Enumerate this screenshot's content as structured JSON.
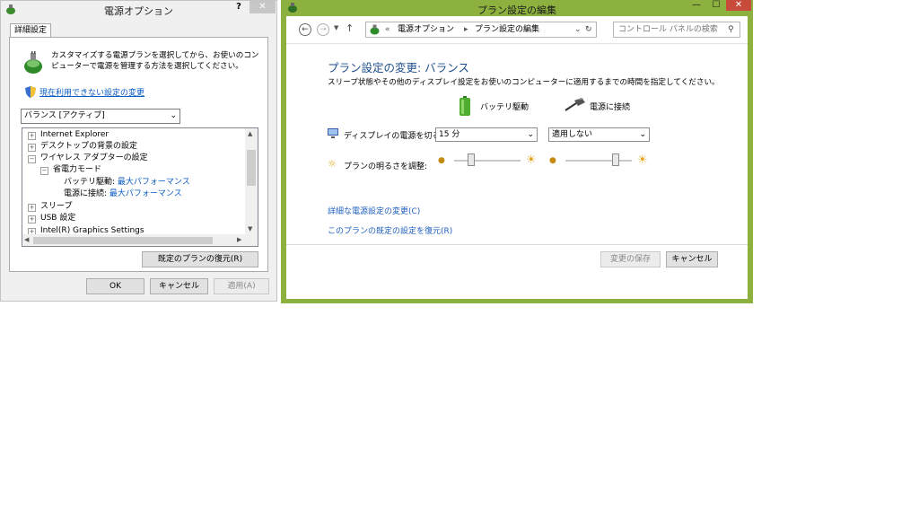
{
  "dialog": {
    "title": "電源オプション",
    "help": "?",
    "close": "✕",
    "tab": "詳細設定",
    "description": "カスタマイズする電源プランを選択してから、お使いのコンピューターで電源を管理する方法を選択してください。",
    "change_unavailable_link": "現在利用できない設定の変更",
    "plan_select": "バランス [アクティブ]",
    "tree": [
      {
        "exp": "⊞",
        "label": "Internet Explorer"
      },
      {
        "exp": "⊞",
        "label": "デスクトップの背景の設定"
      },
      {
        "exp": "⊟",
        "label": "ワイヤレス アダプターの設定"
      },
      {
        "exp": "⊟",
        "label": "省電力モード"
      },
      {
        "label": "バッテリ駆動:",
        "value": "最大パフォーマンス"
      },
      {
        "label": "電源に接続:",
        "value": "最大パフォーマンス"
      },
      {
        "exp": "⊞",
        "label": "スリープ"
      },
      {
        "exp": "⊞",
        "label": "USB 設定"
      },
      {
        "exp": "⊞",
        "label": "Intel(R) Graphics Settings"
      }
    ],
    "restore_button": "既定のプランの復元(R)",
    "ok": "OK",
    "cancel": "キャンセル",
    "apply": "適用(A)"
  },
  "window": {
    "title": "プラン設定の編集",
    "minimize": "—",
    "maximize": "☐",
    "close": "✕",
    "breadcrumb_prefix": "«",
    "breadcrumb": [
      "電源オプション",
      "プラン設定の編集"
    ],
    "search_placeholder": "コントロール パネルの検索",
    "page_title": "プラン設定の変更: バランス",
    "page_subtitle": "スリープ状態やその他のディスプレイ設定をお使いのコンピューターに適用するまでの時間を指定してください。",
    "col_battery": "バッテリ駆動",
    "col_plugged": "電源に接続",
    "display_off_label": "ディスプレイの電源を切る:",
    "display_off_battery": "15 分",
    "display_off_plugged": "適用しない",
    "brightness_label": "プランの明るさを調整:",
    "brightness_battery": 0.25,
    "brightness_plugged": 0.75,
    "advanced_link": "詳細な電源設定の変更(C)",
    "restore_link": "このプランの既定の設定を復元(R)",
    "save_button": "変更の保存",
    "cancel_button": "キャンセル"
  },
  "colors": {
    "window_frame": "#8cb13f",
    "link": "#1f5fbf",
    "title_blue": "#1e4e8c",
    "close_red": "#c74a3a"
  }
}
